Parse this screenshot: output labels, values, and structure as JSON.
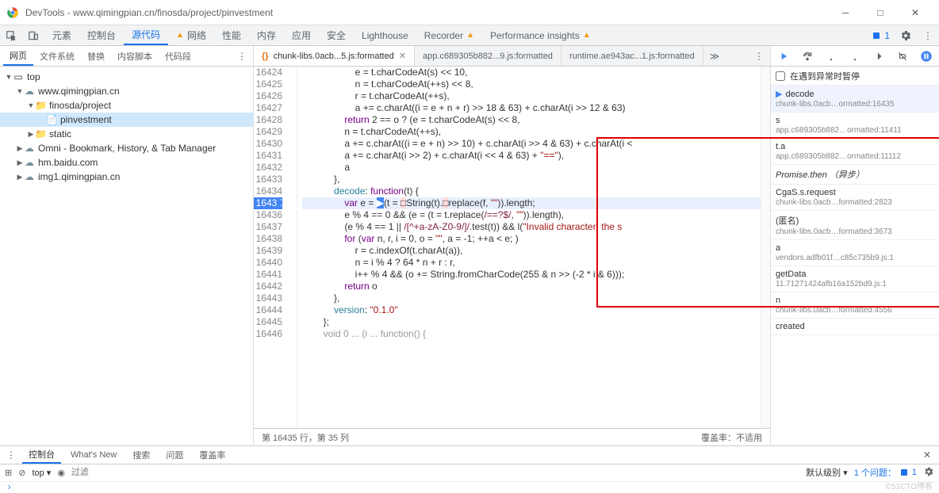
{
  "titlebar": {
    "title": "DevTools - www.qimingpian.cn/finosda/project/pinvestment"
  },
  "maintabs": {
    "items": [
      "元素",
      "控制台",
      "源代码",
      "网络",
      "性能",
      "内存",
      "应用",
      "安全",
      "Lighthouse",
      "Recorder",
      "Performance insights"
    ],
    "activeIndex": 2,
    "issues_count": "1"
  },
  "lefttabs": {
    "items": [
      "网页",
      "文件系统",
      "替换",
      "内容脚本",
      "代码段"
    ],
    "activeIndex": 0
  },
  "tree": [
    {
      "depth": 0,
      "caret": "▼",
      "icon": "window",
      "label": "top"
    },
    {
      "depth": 1,
      "caret": "▼",
      "icon": "cloud",
      "label": "www.qimingpian.cn"
    },
    {
      "depth": 2,
      "caret": "▼",
      "icon": "folder",
      "label": "finosda/project"
    },
    {
      "depth": 3,
      "caret": "",
      "icon": "file",
      "label": "pinvestment",
      "selected": true
    },
    {
      "depth": 2,
      "caret": "▶",
      "icon": "folder",
      "label": "static"
    },
    {
      "depth": 1,
      "caret": "▶",
      "icon": "cloud",
      "label": "Omni - Bookmark, History, & Tab Manager"
    },
    {
      "depth": 1,
      "caret": "▶",
      "icon": "cloud",
      "label": "hm.baidu.com"
    },
    {
      "depth": 1,
      "caret": "▶",
      "icon": "cloud",
      "label": "img1.qimingpian.cn"
    }
  ],
  "editortabs": {
    "items": [
      {
        "label": "chunk-libs.0acb...5.js:formatted",
        "active": true,
        "closeable": true
      },
      {
        "label": "app.c689305b882...9.js:formatted",
        "active": false
      },
      {
        "label": "runtime.ae943ac...1.js:formatted",
        "active": false
      }
    ]
  },
  "code_lines": [
    {
      "n": 16424,
      "html": "                    e = t.charCodeAt(s) << 10,"
    },
    {
      "n": 16425,
      "html": "                    n = t.charCodeAt(++s) << 8,"
    },
    {
      "n": 16426,
      "html": "                    r = t.charCodeAt(++s),"
    },
    {
      "n": 16427,
      "html": "                    a += c.charAt((i = e + n + r) >> 18 & 63) + c.charAt(i >> 12 & 63)"
    },
    {
      "n": 16428,
      "html": "                <span class='kw'>return</span> 2 == o ? (e = t.charCodeAt(s) << 8,"
    },
    {
      "n": 16429,
      "html": "                n = t.charCodeAt(++s),"
    },
    {
      "n": 16430,
      "html": "                a += c.charAt((i = e + n) >> 10) + c.charAt(i >> 4 & 63) + c.charAt(i <"
    },
    {
      "n": 16431,
      "html": "                a += c.charAt(i >> 2) + c.charAt(i << 4 & 63) + <span class='str'>\"==\"</span>),"
    },
    {
      "n": 16432,
      "html": "                a"
    },
    {
      "n": 16433,
      "html": "            },"
    },
    {
      "n": 16434,
      "html": "            <span class='prop'>decode</span>: <span class='kw'>function</span>(t) {"
    },
    {
      "n": 16435,
      "html": "                <span class='kw'>var</span> e = <span style='background:#4285f4;color:#fff'>▶</span>(t = <span style='background:#fdd'>□</span>String(t).<span style='background:#fdd'>□</span>replace(f, <span class='str'>\"\"</span>)).length;",
      "exec": true
    },
    {
      "n": 16436,
      "html": "                e % 4 == 0 && (e = (t = t.replace(<span class='regx'>/==?$/</span>, <span class='str'>\"\"</span>)).length),"
    },
    {
      "n": 16437,
      "html": "                (e % 4 == 1 || <span class='regx'>/[^+a-zA-Z0-9/]/</span>.test(t)) && l(<span class='str'>\"Invalid character: the s</span>"
    },
    {
      "n": 16438,
      "html": "                <span class='kw'>for</span> (<span class='kw'>var</span> n, r, i = 0, o = <span class='str'>\"\"</span>, a = -1; ++a < e; )"
    },
    {
      "n": 16439,
      "html": "                    r = c.indexOf(t.charAt(a)),"
    },
    {
      "n": 16440,
      "html": "                    n = i % 4 ? 64 * n + r : r,"
    },
    {
      "n": 16441,
      "html": "                    i++ % 4 && (o += String.fromCharCode(255 & n >> (-2 * i & 6)));"
    },
    {
      "n": 16442,
      "html": "                <span class='kw'>return</span> o"
    },
    {
      "n": 16443,
      "html": "            },"
    },
    {
      "n": 16444,
      "html": "            <span class='prop'>version</span>: <span class='str'>\"0.1.0\"</span>"
    },
    {
      "n": 16445,
      "html": "        };"
    },
    {
      "n": 16446,
      "html": "        <span style='color:#999'>void 0 ... (i ... function() {</span>"
    }
  ],
  "statusbar": {
    "pos": "第 16435 行，第 35 列",
    "coverage": "覆盖率：不适用"
  },
  "debug": {
    "pause_label": "在遇到异常时暂停",
    "stack": [
      {
        "name": "decode",
        "loc": "chunk-libs.0acb…ormatted:16435",
        "current": true
      },
      {
        "name": "s",
        "loc": "app.c689305b882…ormatted:11411"
      },
      {
        "name": "t.a",
        "loc": "app.c689305b882…ormatted:11112"
      },
      {
        "name": "Promise.then （异步）",
        "loc": "",
        "async": true
      },
      {
        "name": "CgaS.s.request",
        "loc": "chunk-libs.0acb…formatted:2823"
      },
      {
        "name": "(匿名)",
        "loc": "chunk-libs.0acb…formatted:3673"
      },
      {
        "name": "a",
        "loc": "vendors.adfb01f…c85c735b9.js:1"
      },
      {
        "name": "getData",
        "loc": "11.71271424afb16a152bd9.js:1"
      },
      {
        "name": "n",
        "loc": "chunk-libs.0acb…formatted:4556"
      },
      {
        "name": "created",
        "loc": ""
      }
    ]
  },
  "drawer": {
    "tabs": [
      "控制台",
      "What's New",
      "搜索",
      "问题",
      "覆盖率"
    ],
    "activeIndex": 0,
    "level": "默认级别",
    "issues": "1 个问题：",
    "issues_count": "1",
    "top_label": "top",
    "filter_placeholder": "过滤"
  },
  "watermark": "©51CTO博客"
}
